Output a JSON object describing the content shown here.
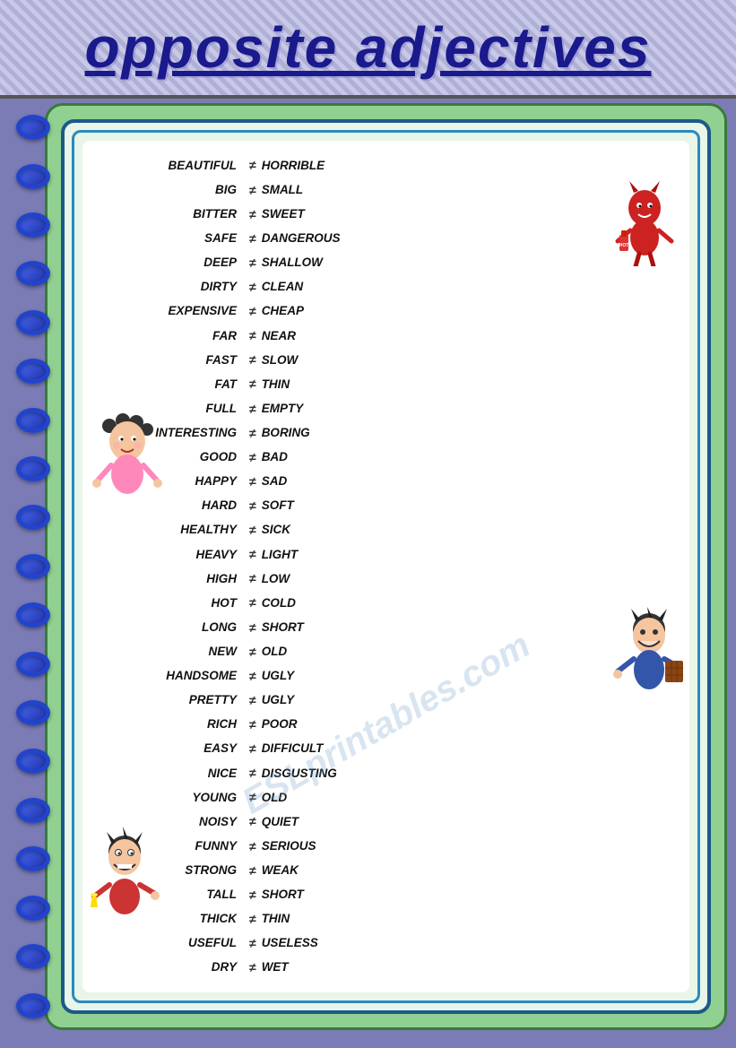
{
  "header": {
    "title": "opposite adjectives"
  },
  "adjectives": [
    {
      "left": "BEAUTIFUL",
      "right": "HORRIBLE"
    },
    {
      "left": "BIG",
      "right": "SMALL"
    },
    {
      "left": "BITTER",
      "right": "SWEET"
    },
    {
      "left": "SAFE",
      "right": "DANGEROUS"
    },
    {
      "left": "DEEP",
      "right": "SHALLOW"
    },
    {
      "left": "DIRTY",
      "right": "CLEAN"
    },
    {
      "left": "EXPENSIVE",
      "right": "CHEAP"
    },
    {
      "left": "FAR",
      "right": "NEAR"
    },
    {
      "left": "FAST",
      "right": "SLOW"
    },
    {
      "left": "FAT",
      "right": "THIN"
    },
    {
      "left": "FULL",
      "right": "EMPTY"
    },
    {
      "left": "INTERESTING",
      "right": "BORING"
    },
    {
      "left": "GOOD",
      "right": "BAD"
    },
    {
      "left": "HAPPY",
      "right": "SAD"
    },
    {
      "left": "HARD",
      "right": "SOFT"
    },
    {
      "left": "HEALTHY",
      "right": "SICK"
    },
    {
      "left": "HEAVY",
      "right": "LIGHT"
    },
    {
      "left": "HIGH",
      "right": "LOW"
    },
    {
      "left": "HOT",
      "right": "COLD"
    },
    {
      "left": "LONG",
      "right": "SHORT"
    },
    {
      "left": "NEW",
      "right": "OLD"
    },
    {
      "left": "HANDSOME",
      "right": "UGLY"
    },
    {
      "left": "PRETTY",
      "right": "UGLY"
    },
    {
      "left": "RICH",
      "right": "POOR"
    },
    {
      "left": "EASY",
      "right": "DIFFICULT"
    },
    {
      "left": "NICE",
      "right": "DISGUSTING"
    },
    {
      "left": "YOUNG",
      "right": "OLD"
    },
    {
      "left": "NOISY",
      "right": "QUIET"
    },
    {
      "left": "FUNNY",
      "right": "SERIOUS"
    },
    {
      "left": "STRONG",
      "right": "WEAK"
    },
    {
      "left": "TALL",
      "right": "SHORT"
    },
    {
      "left": "THICK",
      "right": "THIN"
    },
    {
      "left": "USEFUL",
      "right": "USELESS"
    },
    {
      "left": "DRY",
      "right": "WET"
    }
  ],
  "symbol": "≠",
  "watermark": "ESLprintables.com"
}
